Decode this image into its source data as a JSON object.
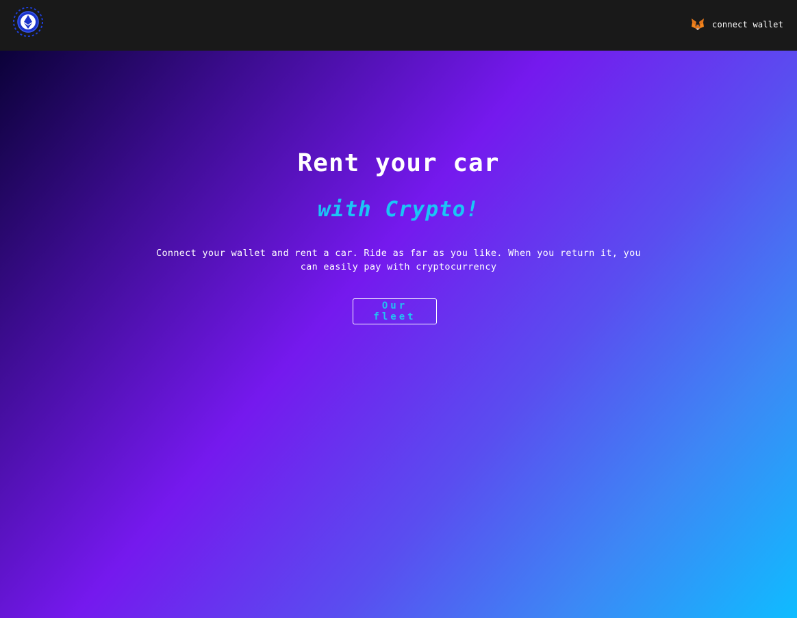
{
  "nav": {
    "logo_icon": "ethereum-gear-logo-icon",
    "wallet_icon": "metamask-fox-icon",
    "wallet_label": "connect wallet"
  },
  "hero": {
    "title": "Rent your car",
    "subtitle": "with Crypto!",
    "description": "Connect your wallet and rent a car. Ride as far as you like. When you return it, you can easily pay with cryptocurrency",
    "fleet_button": "Our fleet"
  },
  "colors": {
    "navbar": "#191919",
    "accent": "#1bc5f6",
    "gradient_start": "#03002a",
    "gradient_mid": "#7519ee",
    "gradient_end": "#0fbcff"
  }
}
